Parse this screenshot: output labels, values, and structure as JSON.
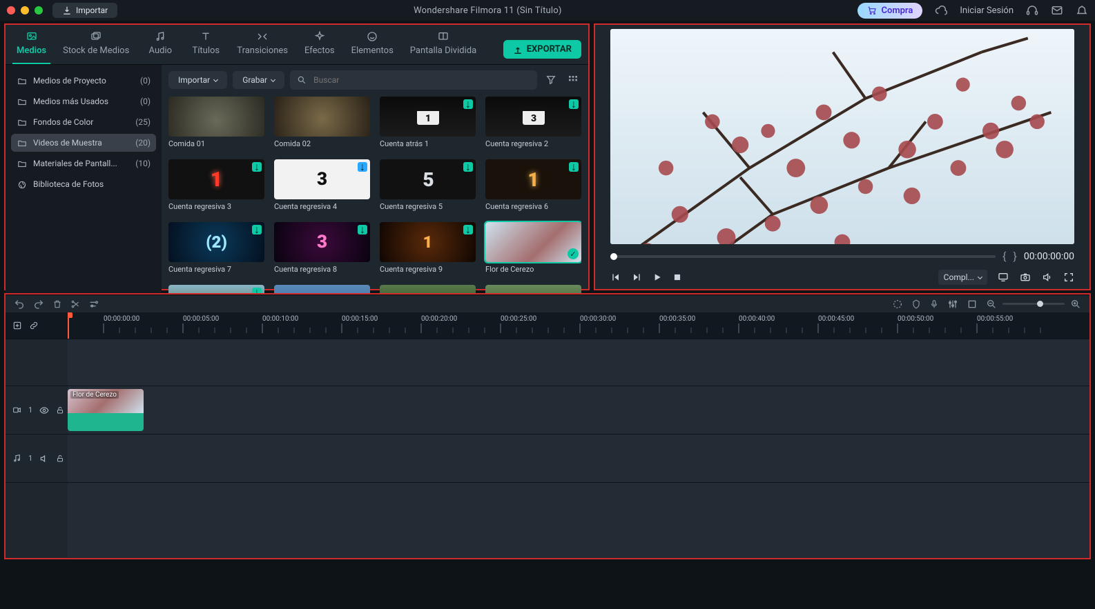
{
  "app": {
    "title": "Wondershare Filmora 11 (Sin Título)"
  },
  "titlebar": {
    "import": "Importar",
    "compra": "Compra",
    "login": "Iniciar Sesión"
  },
  "tabs": [
    {
      "label": "Medios",
      "active": true
    },
    {
      "label": "Stock de Medios",
      "active": false
    },
    {
      "label": "Audio",
      "active": false
    },
    {
      "label": "Títulos",
      "active": false
    },
    {
      "label": "Transiciones",
      "active": false
    },
    {
      "label": "Efectos",
      "active": false
    },
    {
      "label": "Elementos",
      "active": false
    },
    {
      "label": "Pantalla Dividida",
      "active": false
    }
  ],
  "export_label": "EXPORTAR",
  "sidebar": {
    "items": [
      {
        "label": "Medios de Proyecto",
        "count": "(0)"
      },
      {
        "label": "Medios más Usados",
        "count": "(0)"
      },
      {
        "label": "Fondos de Color",
        "count": "(25)"
      },
      {
        "label": "Videos de Muestra",
        "count": "(20)",
        "active": true
      },
      {
        "label": "Materiales de Pantall...",
        "count": "(10)"
      },
      {
        "label": "Biblioteca de Fotos",
        "count": ""
      }
    ]
  },
  "toolbar": {
    "import": "Importar",
    "record": "Grabar",
    "search_placeholder": "Buscar"
  },
  "media": [
    {
      "label": "Comida 01"
    },
    {
      "label": "Comida 02"
    },
    {
      "label": "Cuenta atrás 1"
    },
    {
      "label": "Cuenta regresiva 2"
    },
    {
      "label": "Cuenta regresiva 3"
    },
    {
      "label": "Cuenta regresiva 4"
    },
    {
      "label": "Cuenta regresiva 5"
    },
    {
      "label": "Cuenta regresiva 6"
    },
    {
      "label": "Cuenta regresiva 7"
    },
    {
      "label": "Cuenta regresiva 8"
    },
    {
      "label": "Cuenta regresiva 9"
    },
    {
      "label": "Flor de Cerezo",
      "selected": true
    }
  ],
  "preview": {
    "timecode": "00:00:00:00",
    "quality": "Compl..."
  },
  "timeline": {
    "ticks": [
      "00:00:00:00",
      "00:00:05:00",
      "00:00:10:00",
      "00:00:15:00",
      "00:00:20:00",
      "00:00:25:00",
      "00:00:30:00",
      "00:00:35:00",
      "00:00:40:00",
      "00:00:45:00",
      "00:00:50:00",
      "00:00:55:00"
    ],
    "tracks": {
      "video": {
        "label": "1"
      },
      "audio": {
        "label": "1"
      }
    },
    "clip_label": "Flor de Cerezo"
  }
}
